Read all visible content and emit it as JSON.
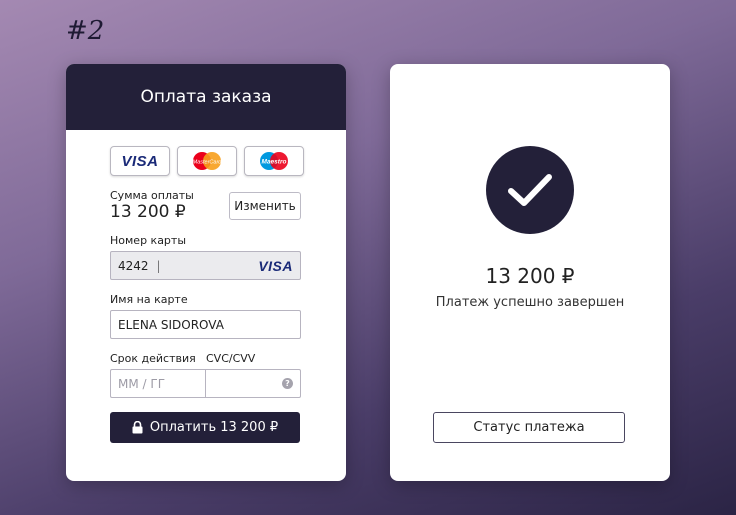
{
  "page_label": "#2",
  "payment_form": {
    "title": "Оплата заказа",
    "card_brands": [
      {
        "name": "visa-logo",
        "text": "VISA"
      },
      {
        "name": "mastercard-logo",
        "text": "MasterCard"
      },
      {
        "name": "maestro-logo",
        "text": "Maestro"
      }
    ],
    "amount_label": "Сумма оплаты",
    "amount_value": "13 200 ₽",
    "change_button": "Изменить",
    "card_number_label": "Номер карты",
    "card_number_value": "4242",
    "card_number_brand": "VISA",
    "name_label": "Имя на карте",
    "name_value": "ELENA SIDOROVA",
    "expiry_label": "Срок действия",
    "expiry_placeholder": "ММ / ГГ",
    "cvc_label": "CVC/CVV",
    "cvc_help": "?",
    "pay_button": "Оплатить 13 200 ₽"
  },
  "success_panel": {
    "amount": "13 200 ₽",
    "message": "Платеж успешно завершен",
    "status_button": "Статус платежа"
  },
  "colors": {
    "dark": "#232039",
    "visa_blue": "#1a2a78",
    "mastercard_red": "#eb001b",
    "mastercard_orange": "#f79e1b",
    "maestro_blue": "#0099df"
  }
}
